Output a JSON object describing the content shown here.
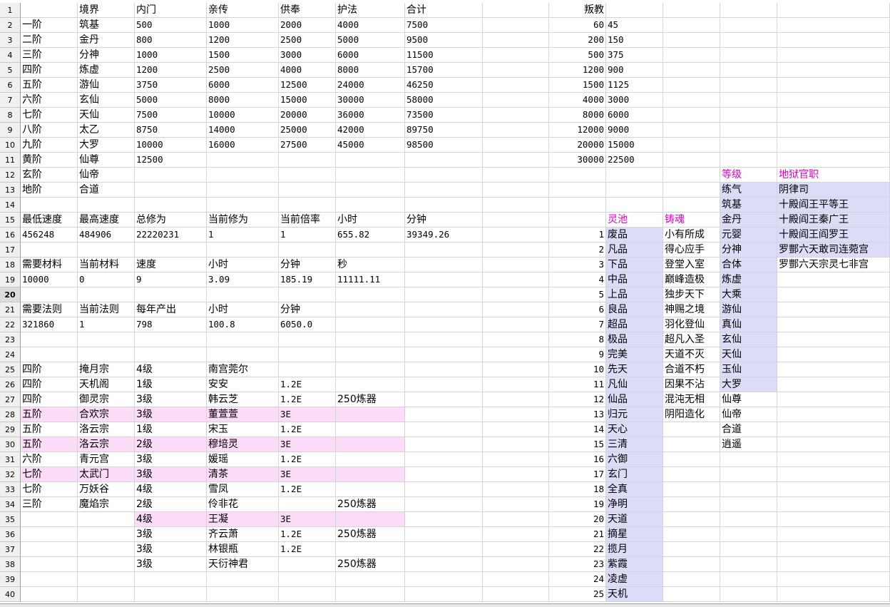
{
  "colors": {
    "magenta": "#e000c8",
    "lavender": "#dcdcf8",
    "pink": "#fcdcf8",
    "header_gray": "#f0f0f0"
  },
  "selected_row": 20,
  "rows": [
    {
      "n": 1,
      "c": {
        "B": "境界",
        "C": "内门",
        "D": "亲传",
        "E": "供奉",
        "F": "护法",
        "G": "合计",
        "I": "叛教"
      }
    },
    {
      "n": 2,
      "c": {
        "A": "一阶",
        "B": "筑基",
        "C": "500",
        "D": "1000",
        "E": "2000",
        "F": "4000",
        "G": "7500",
        "I": "60",
        "J": "45"
      }
    },
    {
      "n": 3,
      "c": {
        "A": "二阶",
        "B": "金丹",
        "C": "800",
        "D": "1200",
        "E": "2500",
        "F": "5000",
        "G": "9500",
        "I": "200",
        "J": "150"
      }
    },
    {
      "n": 4,
      "c": {
        "A": "三阶",
        "B": "分神",
        "C": "1000",
        "D": "1500",
        "E": "3000",
        "F": "6000",
        "G": "11500",
        "I": "500",
        "J": "375"
      }
    },
    {
      "n": 5,
      "c": {
        "A": "四阶",
        "B": "炼虚",
        "C": "1200",
        "D": "2500",
        "E": "4000",
        "F": "8000",
        "G": "15700",
        "I": "1200",
        "J": "900"
      }
    },
    {
      "n": 6,
      "c": {
        "A": "五阶",
        "B": "游仙",
        "C": "3750",
        "D": "6000",
        "E": "12500",
        "F": "24000",
        "G": "46250",
        "I": "1500",
        "J": "1125"
      }
    },
    {
      "n": 7,
      "c": {
        "A": "六阶",
        "B": "玄仙",
        "C": "5000",
        "D": "8000",
        "E": "15000",
        "F": "30000",
        "G": "58000",
        "I": "4000",
        "J": "3000"
      }
    },
    {
      "n": 8,
      "c": {
        "A": "七阶",
        "B": "天仙",
        "C": "7500",
        "D": "10000",
        "E": "20000",
        "F": "36000",
        "G": "73500",
        "I": "8000",
        "J": "6000"
      }
    },
    {
      "n": 9,
      "c": {
        "A": "八阶",
        "B": "太乙",
        "C": "8750",
        "D": "14000",
        "E": "25000",
        "F": "42000",
        "G": "89750",
        "I": "12000",
        "J": "9000"
      }
    },
    {
      "n": 10,
      "c": {
        "A": "九阶",
        "B": "大罗",
        "C": "10000",
        "D": "16000",
        "E": "27500",
        "F": "45000",
        "G": "98500",
        "I": "20000",
        "J": "15000"
      }
    },
    {
      "n": 11,
      "c": {
        "A": "黄阶",
        "B": "仙尊",
        "C": "12500",
        "I": "30000",
        "J": "22500"
      }
    },
    {
      "n": 12,
      "c": {
        "A": "玄阶",
        "B": "仙帝",
        "M": "等级",
        "N": "地狱官职"
      }
    },
    {
      "n": 13,
      "c": {
        "A": "地阶",
        "B": "合道",
        "M": "练气",
        "N": "阴律司"
      }
    },
    {
      "n": 14,
      "c": {
        "M": "筑基",
        "N": "十殿阎王平等王"
      }
    },
    {
      "n": 15,
      "c": {
        "A": "最低速度",
        "B": "最高速度",
        "C": "总修为",
        "D": "当前修为",
        "E": "当前倍率",
        "F": "小时",
        "G": "分钟",
        "J": "灵池",
        "K": "铸魂",
        "M": "金丹",
        "N": "十殿阎王秦广王"
      }
    },
    {
      "n": 16,
      "c": {
        "A": "456248",
        "B": "484906",
        "C": "22220231",
        "D": "1",
        "E": "1",
        "F": "655.82",
        "G": "39349.26",
        "I": "1",
        "J": "废品",
        "K": "小有所成",
        "M": "元婴",
        "N": "十殿阎王阎罗王"
      }
    },
    {
      "n": 17,
      "c": {
        "I": "2",
        "J": "凡品",
        "K": "得心应手",
        "M": "分神",
        "N": "罗酆六天敢司连菀宫"
      }
    },
    {
      "n": 18,
      "c": {
        "A": "需要材料",
        "B": "当前材料",
        "C": "速度",
        "D": "小时",
        "E": "分钟",
        "F": "秒",
        "I": "3",
        "J": "下品",
        "K": "登堂入室",
        "M": "合体",
        "N": "罗酆六天宗灵七非宫"
      }
    },
    {
      "n": 19,
      "c": {
        "A": "10000",
        "B": "0",
        "C": "9",
        "D": "3.09",
        "E": "185.19",
        "F": "11111.11",
        "I": "4",
        "J": "中品",
        "K": "巅峰造极",
        "M": "炼虚"
      }
    },
    {
      "n": 20,
      "c": {
        "I": "5",
        "J": "上品",
        "K": "独步天下",
        "M": "大乘"
      }
    },
    {
      "n": 21,
      "c": {
        "A": "需要法则",
        "B": "当前法则",
        "C": "每年产出",
        "D": "小时",
        "E": "分钟",
        "I": "6",
        "J": "良品",
        "K": "神赐之境",
        "M": "游仙"
      }
    },
    {
      "n": 22,
      "c": {
        "A": "321860",
        "B": "1",
        "C": "798",
        "D": "100.8",
        "E": "6050.0",
        "I": "7",
        "J": "超品",
        "K": "羽化登仙",
        "M": "真仙"
      }
    },
    {
      "n": 23,
      "c": {
        "I": "8",
        "J": "极品",
        "K": "超凡入圣",
        "M": "玄仙"
      }
    },
    {
      "n": 24,
      "c": {
        "I": "9",
        "J": "完美",
        "K": "天道不灭",
        "M": "天仙"
      }
    },
    {
      "n": 25,
      "c": {
        "A": "四阶",
        "B": "掩月宗",
        "C": "4级",
        "D": "南宫莞尔",
        "I": "10",
        "J": "先天",
        "K": "合道不朽",
        "M": "玉仙"
      }
    },
    {
      "n": 26,
      "c": {
        "A": "四阶",
        "B": "天机阁",
        "C": "1级",
        "D": "安安",
        "E": "1.2E",
        "I": "11",
        "J": "凡仙",
        "K": "因果不沾",
        "M": "大罗"
      }
    },
    {
      "n": 27,
      "c": {
        "A": "四阶",
        "B": "御灵宗",
        "C": "3级",
        "D": "韩云芝",
        "E": "1.2E",
        "F": "250炼器",
        "I": "12",
        "J": "仙品",
        "K": "混沌无相",
        "M": "仙尊"
      }
    },
    {
      "n": 28,
      "c": {
        "A": "五阶",
        "B": "合欢宗",
        "C": "3级",
        "D": "董萱萱",
        "E": "3E",
        "I": "13",
        "J": "归元",
        "K": "阴阳造化",
        "M": "仙帝"
      }
    },
    {
      "n": 29,
      "c": {
        "A": "五阶",
        "B": "洛云宗",
        "C": "1级",
        "D": "宋玉",
        "E": "1.2E",
        "I": "14",
        "J": "天心",
        "M": "合道"
      }
    },
    {
      "n": 30,
      "c": {
        "A": "五阶",
        "B": "洛云宗",
        "C": "2级",
        "D": "穆培灵",
        "E": "3E",
        "I": "15",
        "J": "三清",
        "M": "逍遥"
      }
    },
    {
      "n": 31,
      "c": {
        "A": "六阶",
        "B": "青元宫",
        "C": "3级",
        "D": "媛瑶",
        "E": "1.2E",
        "I": "16",
        "J": "六御"
      }
    },
    {
      "n": 32,
      "c": {
        "A": "七阶",
        "B": "太武门",
        "C": "3级",
        "D": "清茶",
        "E": "3E",
        "I": "17",
        "J": "玄门"
      }
    },
    {
      "n": 33,
      "c": {
        "A": "七阶",
        "B": "万妖谷",
        "C": "4级",
        "D": "雪凤",
        "E": "1.2E",
        "I": "18",
        "J": "全真"
      }
    },
    {
      "n": 34,
      "c": {
        "A": "三阶",
        "B": "魔焰宗",
        "C": "2级",
        "D": "伶非花",
        "F": "250炼器",
        "I": "19",
        "J": "净明"
      }
    },
    {
      "n": 35,
      "c": {
        "C": "4级",
        "D": "王凝",
        "E": "3E",
        "I": "20",
        "J": "天道"
      }
    },
    {
      "n": 36,
      "c": {
        "C": "3级",
        "D": "齐云萧",
        "E": "1.2E",
        "F": "250炼器",
        "I": "21",
        "J": "摘星"
      }
    },
    {
      "n": 37,
      "c": {
        "C": "3级",
        "D": "林银瓶",
        "E": "1.2E",
        "I": "22",
        "J": "揽月"
      }
    },
    {
      "n": 38,
      "c": {
        "C": "3级",
        "D": "天衍神君",
        "F": "250炼器",
        "I": "23",
        "J": "紫霞"
      }
    },
    {
      "n": 39,
      "c": {
        "I": "24",
        "J": "凌虚"
      }
    },
    {
      "n": 40,
      "c": {
        "I": "25",
        "J": "天机"
      }
    }
  ]
}
